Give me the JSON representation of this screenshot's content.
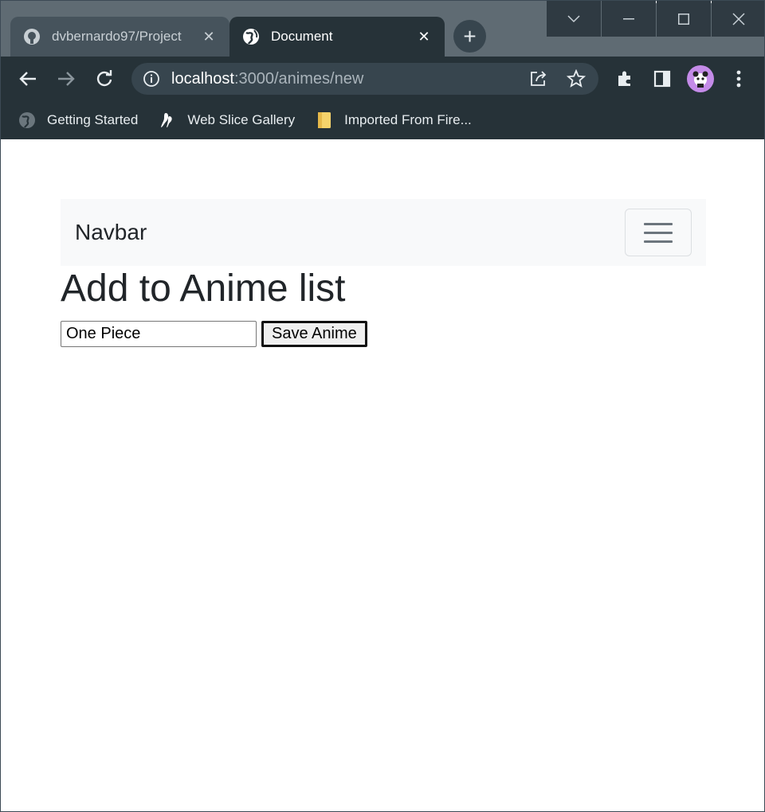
{
  "browser": {
    "tabs": [
      {
        "title": "dvbernardo97/Project",
        "icon": "github-icon",
        "active": false
      },
      {
        "title": "Document",
        "icon": "globe-icon",
        "active": true
      }
    ],
    "address_host": "localhost",
    "address_path": ":3000/animes/new",
    "bookmarks": [
      {
        "label": "Getting Started",
        "icon": "globe-icon"
      },
      {
        "label": "Web Slice Gallery",
        "icon": "slice-icon"
      },
      {
        "label": "Imported From Fire...",
        "icon": "folder-icon"
      }
    ]
  },
  "page": {
    "navbar": {
      "brand": "Navbar"
    },
    "heading": "Add to Anime list",
    "form": {
      "input_value": "One Piece",
      "submit_label": "Save Anime"
    }
  }
}
